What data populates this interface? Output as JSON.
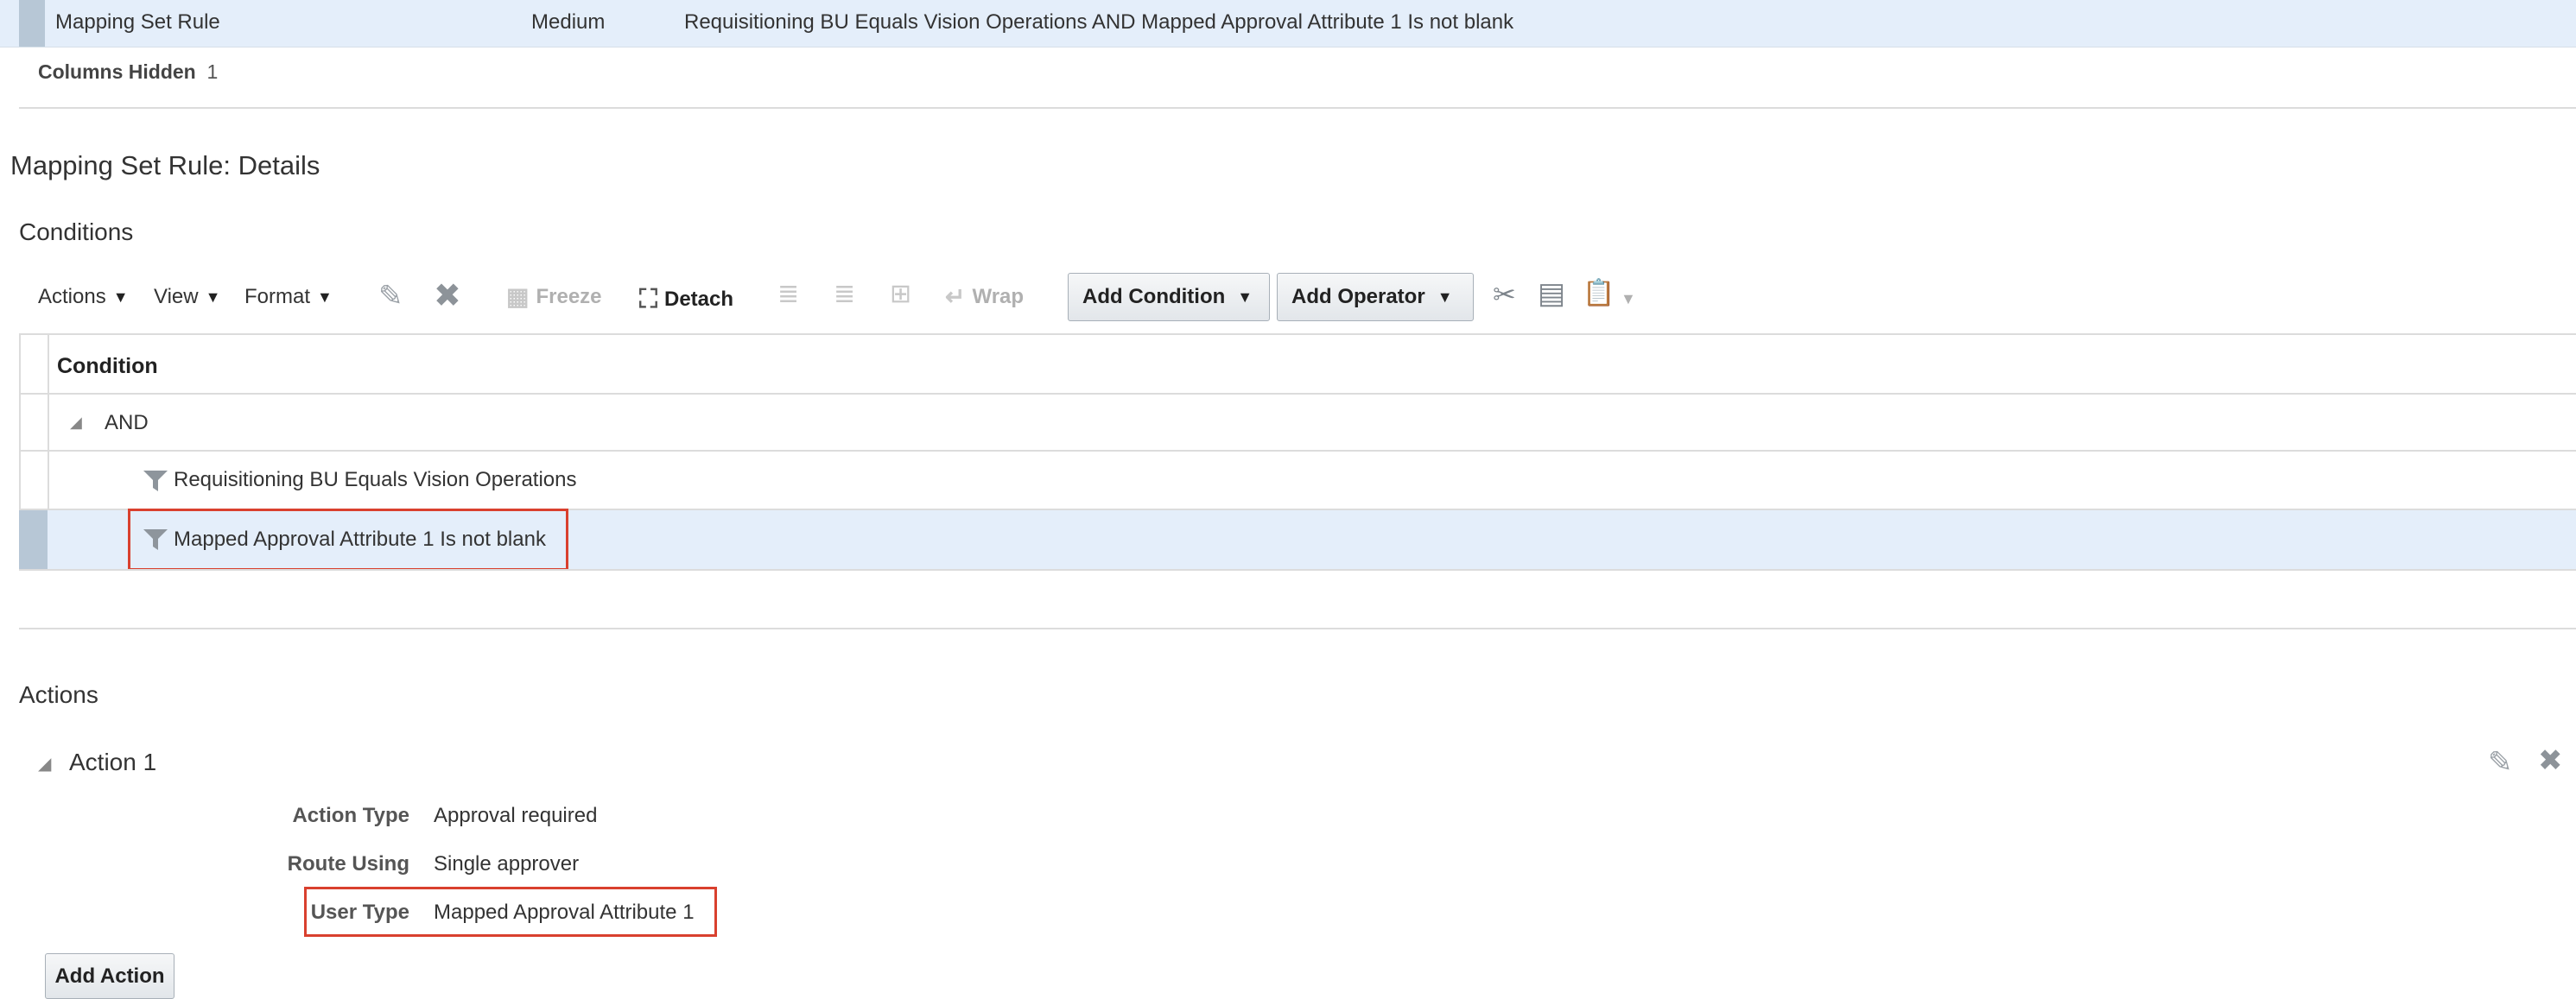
{
  "summary_row": {
    "name": "Mapping Set Rule",
    "priority": "Medium",
    "condition": "Requisitioning BU Equals Vision Operations AND Mapped Approval Attribute 1 Is not blank"
  },
  "columns_hidden": {
    "label": "Columns Hidden",
    "count": "1"
  },
  "details_title": "Mapping Set Rule: Details",
  "conditions": {
    "title": "Conditions",
    "toolbar": {
      "actions": "Actions",
      "view": "View",
      "format": "Format",
      "freeze": "Freeze",
      "detach": "Detach",
      "wrap": "Wrap",
      "add_condition": "Add Condition",
      "add_operator": "Add Operator"
    },
    "column_header": "Condition",
    "rows": {
      "operator": "AND",
      "condition_1": "Requisitioning BU Equals Vision Operations",
      "condition_2": "Mapped Approval Attribute 1 Is not blank"
    }
  },
  "actions_section": {
    "title": "Actions",
    "action_name": "Action 1",
    "fields": {
      "action_type_label": "Action Type",
      "action_type_value": "Approval required",
      "route_using_label": "Route Using",
      "route_using_value": "Single approver",
      "user_type_label": "User Type",
      "user_type_value": "Mapped Approval Attribute 1"
    },
    "add_action": "Add Action"
  },
  "colors": {
    "highlight": "#d9402e",
    "selected_row": "#e4eefa"
  }
}
